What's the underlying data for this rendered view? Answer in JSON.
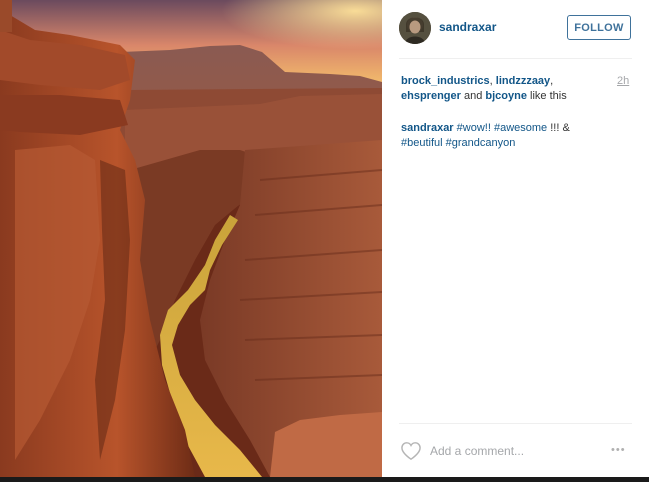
{
  "post": {
    "username": "sandraxar",
    "follow_label": "FOLLOW",
    "time_ago": "2h",
    "likes": {
      "users": [
        "brock_industrics",
        "lindzzzaay",
        "ehsprenger",
        "bjcoyne"
      ],
      "separator": ", ",
      "joiner": " and ",
      "suffix": " like this"
    },
    "caption": {
      "user": "sandraxar",
      "tags": [
        "#wow!!",
        "#awesome"
      ],
      "middle_text": " !!! & ",
      "tags2": [
        "#beutiful",
        "#grandcanyon"
      ]
    },
    "comment_placeholder": "Add a comment...",
    "more_label": "•••"
  },
  "colors": {
    "link": "#125688",
    "follow": "#3f729b",
    "muted": "#a5a7aa"
  },
  "icons": {
    "like": "heart-outline-icon",
    "more": "ellipsis-icon"
  }
}
